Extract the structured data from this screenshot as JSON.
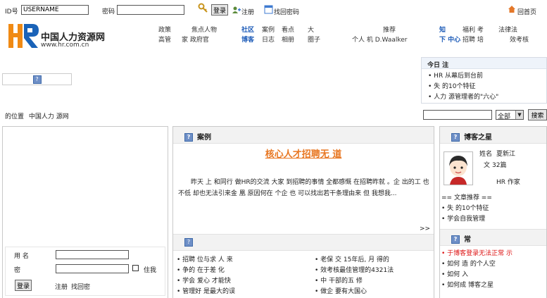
{
  "login": {
    "id_label": "ID号",
    "username_value": "USERNAME",
    "password_label": "密码",
    "login_button": "登录",
    "register_link": "注册",
    "find_password_link": "找回密码",
    "home_link": "回首页"
  },
  "logo": {
    "site_name": "中国人力资源网",
    "site_url": "www.hr.com.cn",
    "logo_letters": "HR"
  },
  "nav": {
    "col1": [
      "政策",
      "高管"
    ],
    "col2": [
      "焦点人物",
      "家  政府官"
    ],
    "col3": [
      "社区",
      "博客"
    ],
    "col4": [
      "案例",
      "日志"
    ],
    "col5": [
      "看点",
      "相册"
    ],
    "col6": [
      "大",
      "圈子"
    ],
    "col7": [
      "推荐",
      "个人  机  D.Waalker"
    ],
    "col8": [
      "知",
      "下  中心"
    ],
    "col9": [
      "福利  考",
      "招聘  培"
    ],
    "col10": [
      "法律法",
      "效考核"
    ]
  },
  "notice": {
    "title": "今日 注",
    "items": [
      "HR 从幕后到台前",
      "失 的10个特征",
      "人力 源管理者的\"六心\""
    ]
  },
  "breadcrumb": {
    "label": "的位置",
    "path": "中国人力 源网"
  },
  "search": {
    "scope_value": "全部",
    "button": "搜索"
  },
  "left_login": {
    "user_label": "用 名",
    "pass_label": "密",
    "remember_label": "住我",
    "login_button": "登录",
    "register_link": "注册",
    "find_password_link": "找回密"
  },
  "case_panel": {
    "title": "案例",
    "headline": "核心人才招聘无 道",
    "body": "昨天 上 和同行 做HR的交流 大家 到招聘的事情 全都感慨 在招聘昨就  。企 出的工 也不低 却也无法引来金 凰 原因何在 个企 也 可以找出若干条理由来 但 我想我...",
    "more": ">>",
    "list_col1": [
      "招聘 位与求 人  来",
      "争的  在于差 化",
      "学会 爱心 才能快",
      "管理好 是最大的误"
    ],
    "list_col2": [
      "老保 交 15年后, 月 得的",
      "效考核最佳管理的4321法",
      "中 干部的五 修",
      "做企 要有大国心"
    ]
  },
  "blog_star": {
    "title": "博客之星",
    "name_label": "姓名",
    "name_value": "夏新江",
    "count_label": "文",
    "count_value": "32篇",
    "role": "HR  作家",
    "recommend_title": "== 文章推荐 ==",
    "recommend_items": [
      "失 的10个特征",
      "学会自我管理"
    ]
  },
  "faq_panel": {
    "title": "常",
    "items": [
      "于博客登录无法正常 示",
      "如何 造 的个人空",
      "如何 入",
      "如何成 博客之星"
    ]
  }
}
